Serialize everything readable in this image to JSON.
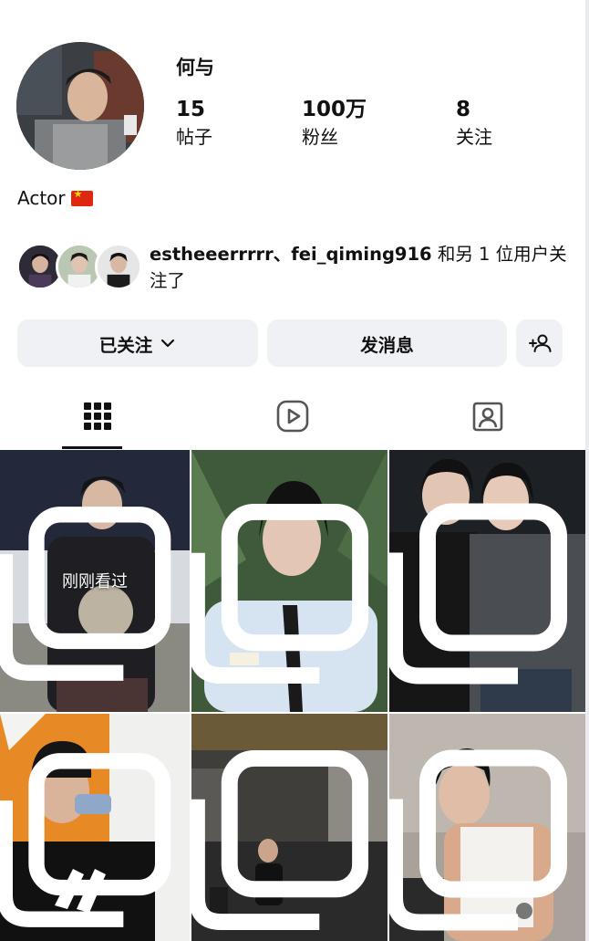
{
  "profile": {
    "name": "何与",
    "bio": "Actor",
    "flag_icon": "china-flag-icon",
    "stats": [
      {
        "value": "15",
        "label": "帖子"
      },
      {
        "value": "100万",
        "label": "粉丝"
      },
      {
        "value": "8",
        "label": "关注"
      }
    ]
  },
  "mutual": {
    "users": "estheeerrrrr、fei_qiming916",
    "suffix": " 和另 1 位用户关注了"
  },
  "actions": {
    "following_label": "已关注",
    "message_label": "发消息",
    "add_user_icon": "add-person-icon"
  },
  "tabs": [
    {
      "name": "grid-icon",
      "active": true
    },
    {
      "name": "reels-icon",
      "active": false
    },
    {
      "name": "tagged-icon",
      "active": false
    }
  ],
  "posts": [
    {
      "overlay": "刚刚看过",
      "multi": true
    },
    {
      "overlay": "",
      "multi": true
    },
    {
      "overlay": "",
      "multi": true
    },
    {
      "overlay": "",
      "multi": true
    },
    {
      "overlay": "",
      "multi": true
    },
    {
      "overlay": "",
      "multi": true
    }
  ],
  "colors": {
    "button_bg": "#eff1f4",
    "text": "#111111"
  }
}
